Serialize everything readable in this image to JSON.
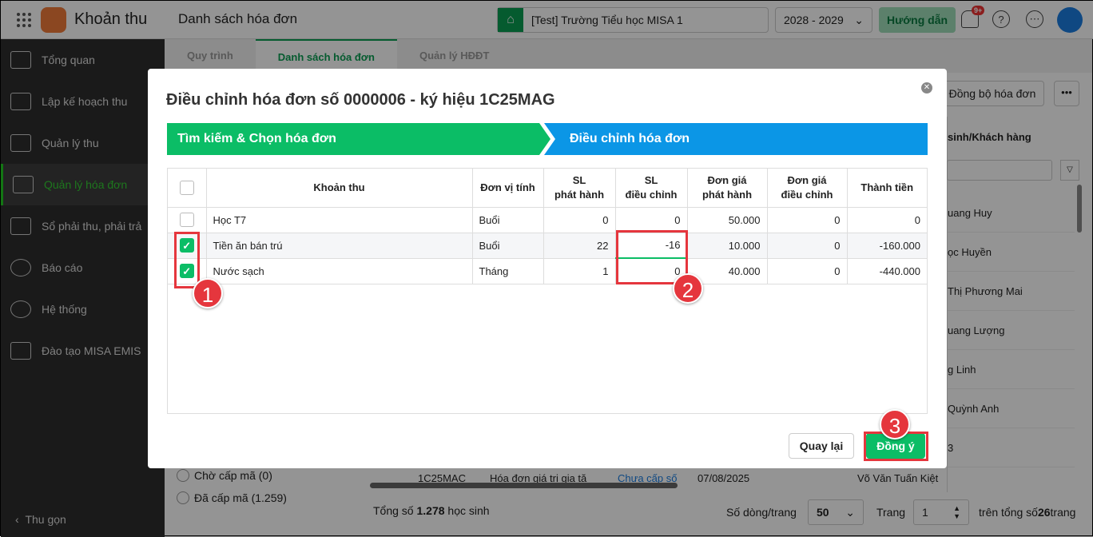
{
  "app": {
    "name": "Khoản thu",
    "page_title": "Danh sách hóa đơn",
    "school": "[Test] Trường Tiểu học MISA 1",
    "year": "2028 - 2029",
    "guide": "Hướng dẫn",
    "notif_badge": "9+"
  },
  "sidebar": {
    "items": [
      {
        "label": "Tổng quan"
      },
      {
        "label": "Lập kế hoạch thu"
      },
      {
        "label": "Quản lý thu"
      },
      {
        "label": "Quản lý hóa đơn"
      },
      {
        "label": "Sổ phải thu, phải trả"
      },
      {
        "label": "Báo cáo"
      },
      {
        "label": "Hệ thống"
      },
      {
        "label": "Đào tạo MISA EMIS"
      }
    ],
    "collapse": "Thu gọn"
  },
  "tabs": [
    {
      "label": "Quy trình"
    },
    {
      "label": "Danh sách hóa đơn"
    },
    {
      "label": "Quản lý HĐĐT"
    }
  ],
  "background": {
    "sync_button": "Đồng bộ hóa đơn",
    "column_header": "sinh/Khách hàng",
    "names": [
      "uang Huy",
      "ọc Huyền",
      "Thị Phương Mai",
      "uang Lượng",
      "g Linh",
      "Quỳnh Anh",
      "3"
    ],
    "row": {
      "symbol": "1C25MAC",
      "type": "Hóa đơn giá trị gia tă",
      "status": "Chưa cấp số",
      "date": "07/08/2025",
      "customer": "Võ Văn Tuấn Kiệt"
    },
    "filters": [
      "Chờ cấp mã (0)",
      "Đã cấp mã (1.259)"
    ],
    "total_prefix": "Tổng số ",
    "total_count": "1.278",
    "total_suffix": " học sinh",
    "rows_per_page_label": "Số dòng/trang",
    "rows_per_page": "50",
    "page_label": "Trang",
    "page": "1",
    "total_pages_prefix": "trên tổng số ",
    "total_pages": "26",
    "total_pages_suffix": " trang"
  },
  "modal": {
    "title": "Điều chỉnh hóa đơn số 0000006 - ký hiệu 1C25MAG",
    "steps": [
      "Tìm kiếm & Chọn hóa đơn",
      "Điều chỉnh hóa đơn"
    ],
    "columns": [
      "Khoản thu",
      "Đơn vị tính",
      "SL\nphát hành",
      "SL\nđiều chỉnh",
      "Đơn giá\nphát hành",
      "Đơn giá\nđiều chỉnh",
      "Thành tiền"
    ],
    "rows": [
      {
        "checked": false,
        "name": "Học T7",
        "unit": "Buổi",
        "qty_issued": "0",
        "qty_adjust": "0",
        "price_issued": "50.000",
        "price_adjust": "0",
        "amount": "0"
      },
      {
        "checked": true,
        "name": "Tiền ăn bán trú",
        "unit": "Buổi",
        "qty_issued": "22",
        "qty_adjust": "-16",
        "price_issued": "10.000",
        "price_adjust": "0",
        "amount": "-160.000"
      },
      {
        "checked": true,
        "name": "Nước sạch",
        "unit": "Tháng",
        "qty_issued": "1",
        "qty_adjust": "0",
        "price_issued": "40.000",
        "price_adjust": "0",
        "amount": "-440.000"
      }
    ],
    "back_button": "Quay lại",
    "ok_button": "Đồng ý"
  },
  "annotations": [
    "1",
    "2",
    "3"
  ],
  "colors": {
    "green": "#0bbd66",
    "blue": "#0b96e6",
    "red": "#e5363d"
  }
}
